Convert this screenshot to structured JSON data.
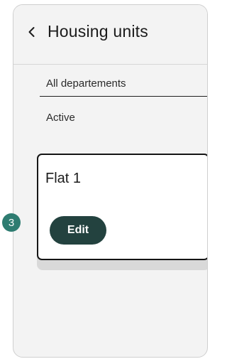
{
  "header": {
    "title": "Housing units",
    "back_icon": "chevron-left-icon"
  },
  "filters": {
    "items": [
      {
        "label": "All departements"
      },
      {
        "label": "Active"
      }
    ]
  },
  "units": [
    {
      "name": "Flat 1",
      "edit_label": "Edit"
    }
  ],
  "annotation": {
    "step_number": "3"
  },
  "colors": {
    "edit_button_bg": "#23423f",
    "step_badge_bg": "#2e7c71",
    "card_border": "#151515",
    "background": "#f3f3f3"
  }
}
